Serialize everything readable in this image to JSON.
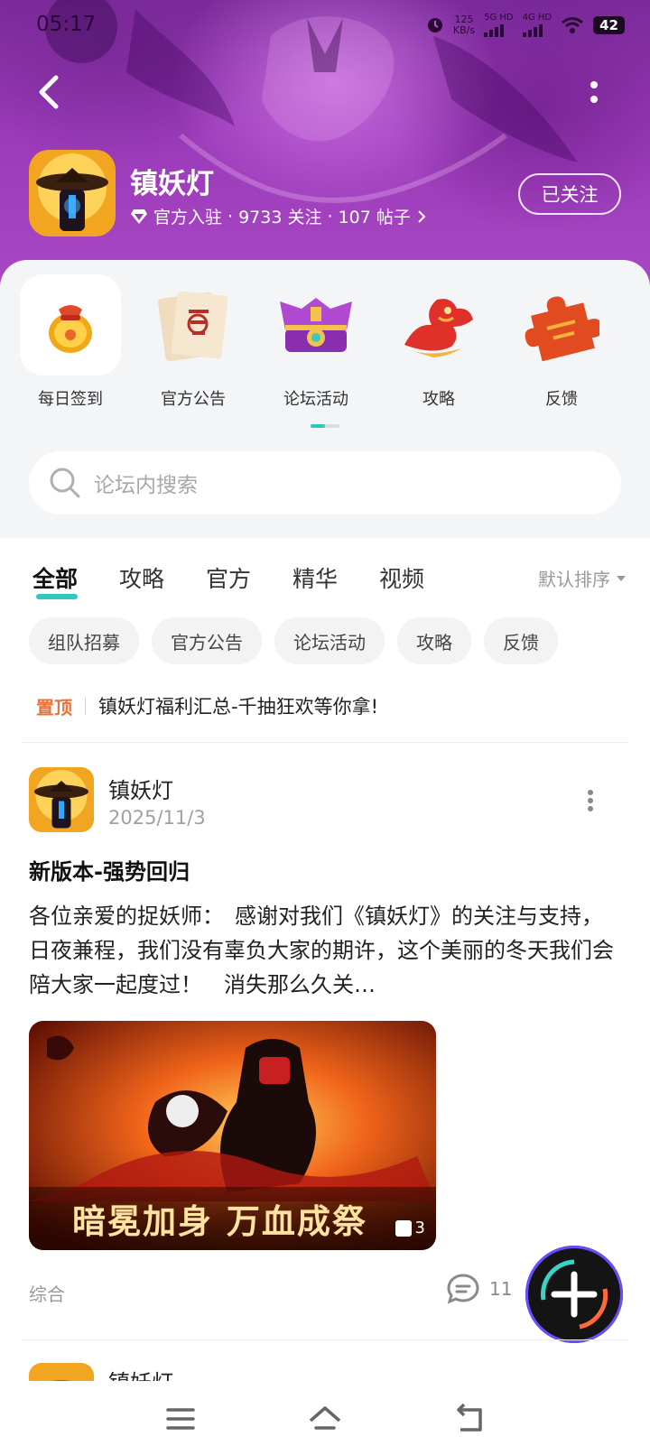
{
  "status_bar": {
    "time": "05:17",
    "speed_value": "125",
    "speed_unit": "KB/s",
    "network_1": "5G HD",
    "network_2": "4G HD",
    "battery": "42"
  },
  "header": {
    "game_name": "镇妖灯",
    "official_label": "官方入驻",
    "followers": "9733 关注",
    "posts": "107 帖子",
    "follow_button": "已关注",
    "colors": {
      "hero_purple": "#9a3ab8",
      "accent_teal": "#2fc7c0"
    }
  },
  "quick_links": [
    {
      "label": "每日签到",
      "icon": "lucky-bag-icon"
    },
    {
      "label": "官方公告",
      "icon": "scroll-notice-icon"
    },
    {
      "label": "论坛活动",
      "icon": "treasure-chest-icon"
    },
    {
      "label": "攻略",
      "icon": "red-dragon-icon"
    },
    {
      "label": "反馈",
      "icon": "puzzle-piece-icon"
    }
  ],
  "search": {
    "placeholder": "论坛内搜索"
  },
  "tabs": [
    "全部",
    "攻略",
    "官方",
    "精华",
    "视频"
  ],
  "sort_label": "默认排序",
  "chips": [
    "组队招募",
    "官方公告",
    "论坛活动",
    "攻略",
    "反馈"
  ],
  "pinned": {
    "badge": "置顶",
    "text": "镇妖灯福利汇总-千抽狂欢等你拿!"
  },
  "post": {
    "author": "镇妖灯",
    "date": "2025/11/3",
    "title": "新版本-强势回归",
    "body": "各位亲爱的捉妖师：　感谢对我们《镇妖灯》的关注与支持，日夜兼程，我们没有辜负大家的期许，这个美丽的冬天我们会陪大家一起度过！　消失那么久关…",
    "image_caption": "暗冕加身 万血成祭",
    "image_count": "3",
    "tag": "综合",
    "comments": "11"
  },
  "next_post": {
    "author": "镇妖灯"
  }
}
